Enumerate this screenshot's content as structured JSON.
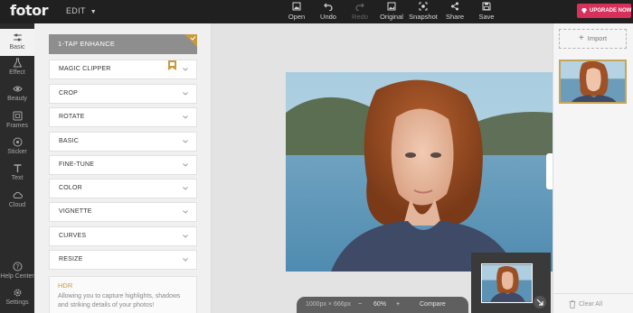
{
  "app": {
    "logo": "fotor",
    "mode_menu": "EDIT"
  },
  "toolbar": [
    {
      "label": "Open",
      "icon": "open-icon",
      "enabled": true
    },
    {
      "label": "Undo",
      "icon": "undo-icon",
      "enabled": true
    },
    {
      "label": "Redo",
      "icon": "redo-icon",
      "enabled": false
    },
    {
      "label": "Original",
      "icon": "original-icon",
      "enabled": true
    },
    {
      "label": "Snapshot",
      "icon": "snapshot-icon",
      "enabled": true
    },
    {
      "label": "Share",
      "icon": "share-icon",
      "enabled": true
    },
    {
      "label": "Save",
      "icon": "save-icon",
      "enabled": true
    }
  ],
  "upgrade": {
    "label": "UPGRADE NOW",
    "color": "#d6305b"
  },
  "leftnav": [
    {
      "label": "Basic",
      "icon": "sliders-icon",
      "active": true
    },
    {
      "label": "Effect",
      "icon": "flask-icon"
    },
    {
      "label": "Beauty",
      "icon": "eye-icon"
    },
    {
      "label": "Frames",
      "icon": "frame-icon"
    },
    {
      "label": "Sticker",
      "icon": "sticker-icon"
    },
    {
      "label": "Text",
      "icon": "text-icon"
    },
    {
      "label": "Cloud",
      "icon": "cloud-icon"
    },
    {
      "label": "Help Center",
      "icon": "help-icon"
    },
    {
      "label": "Settings",
      "icon": "gear-icon"
    }
  ],
  "panel": {
    "enhance": "1-TAP ENHANCE",
    "items": [
      "MAGIC CLIPPER",
      "CROP",
      "ROTATE",
      "BASIC",
      "FINE-TUNE",
      "COLOR",
      "VIGNETTE",
      "CURVES",
      "RESIZE"
    ],
    "hdr": {
      "title": "HDR",
      "desc": "Allowing you to capture highlights, shadows and striking details of your photos!"
    }
  },
  "status": {
    "dimensions": "1000px × 666px",
    "minus": "−",
    "zoom": "60%",
    "plus": "+",
    "compare": "Compare"
  },
  "rightpanel": {
    "import": "Import",
    "clear_all": "Clear All"
  },
  "colors": {
    "accent_gold": "#c79a3c",
    "topbar": "#202020",
    "nav": "#2b2b2b"
  }
}
